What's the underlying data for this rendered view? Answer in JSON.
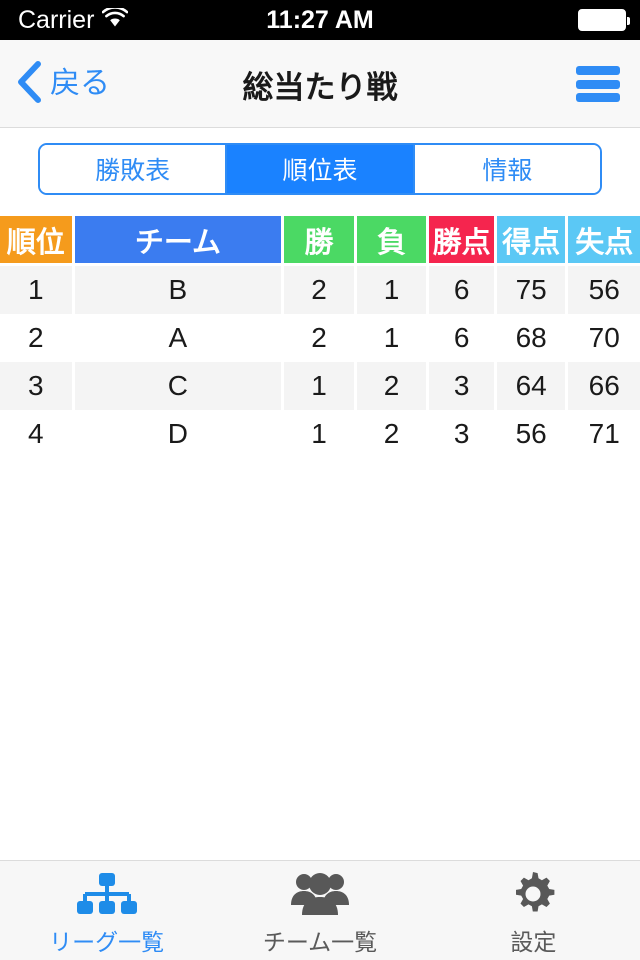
{
  "status_bar": {
    "carrier": "Carrier",
    "wifi_icon": "wifi-icon",
    "time": "11:27 AM",
    "battery_icon": "battery-full-icon"
  },
  "nav_bar": {
    "back_icon": "chevron-left-icon",
    "back_label": "戻る",
    "title": "総当たり戦",
    "menu_icon": "hamburger-menu-icon"
  },
  "segmented_control": {
    "options": [
      {
        "label": "勝敗表",
        "selected": false
      },
      {
        "label": "順位表",
        "selected": true
      },
      {
        "label": "情報",
        "selected": false
      }
    ]
  },
  "standings_table": {
    "columns": [
      {
        "label": "順位",
        "color": "#f59b1c"
      },
      {
        "label": "チーム",
        "color": "#3b7cf0"
      },
      {
        "label": "勝",
        "color": "#4bd964"
      },
      {
        "label": "負",
        "color": "#4bd964"
      },
      {
        "label": "勝点",
        "color": "#f5254e"
      },
      {
        "label": "得点",
        "color": "#5bc8f5"
      },
      {
        "label": "失点",
        "color": "#5bc8f5"
      }
    ],
    "rows": [
      {
        "rank": "1",
        "team": "B",
        "win": "2",
        "lose": "1",
        "points": "6",
        "goals_for": "75",
        "goals_against": "56"
      },
      {
        "rank": "2",
        "team": "A",
        "win": "2",
        "lose": "1",
        "points": "6",
        "goals_for": "68",
        "goals_against": "70"
      },
      {
        "rank": "3",
        "team": "C",
        "win": "1",
        "lose": "2",
        "points": "3",
        "goals_for": "64",
        "goals_against": "66"
      },
      {
        "rank": "4",
        "team": "D",
        "win": "1",
        "lose": "2",
        "points": "3",
        "goals_for": "56",
        "goals_against": "71"
      }
    ]
  },
  "tab_bar": {
    "items": [
      {
        "label": "リーグ一覧",
        "icon": "org-chart-icon",
        "active": true
      },
      {
        "label": "チーム一覧",
        "icon": "people-group-icon",
        "active": false
      },
      {
        "label": "設定",
        "icon": "gear-icon",
        "active": false
      }
    ]
  },
  "colors": {
    "accent_blue": "#2f8cf5",
    "selected_blue": "#1a82ff",
    "row_alt": "#f4f4f4",
    "tab_inactive": "#5a5a5a"
  }
}
